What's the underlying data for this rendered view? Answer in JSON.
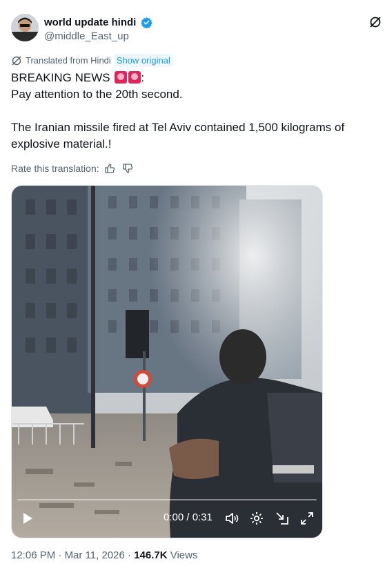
{
  "author": {
    "display_name": "world update hindi",
    "handle": "@middle_East_up",
    "avatar_icon": "avatar-image",
    "verified_color": "#1d9bf0"
  },
  "translation": {
    "label": "Translated from Hindi",
    "show_original": "Show original",
    "rate_label": "Rate this translation:"
  },
  "tweet": {
    "line1": "BREAKING NEWS",
    "line1_suffix": ":",
    "line2": "Pay attention to the 20th second.",
    "line3": "The Iranian missile fired at Tel Aviv contained 1,500 kilograms of explosive material.!"
  },
  "video": {
    "time": "0:00 / 0:31",
    "progress": 0
  },
  "meta": {
    "time": "12:06 PM",
    "separator1": "·",
    "date": "Mar 11, 2026",
    "separator2": "·",
    "views_count": "146.7K",
    "views_label": "Views"
  }
}
